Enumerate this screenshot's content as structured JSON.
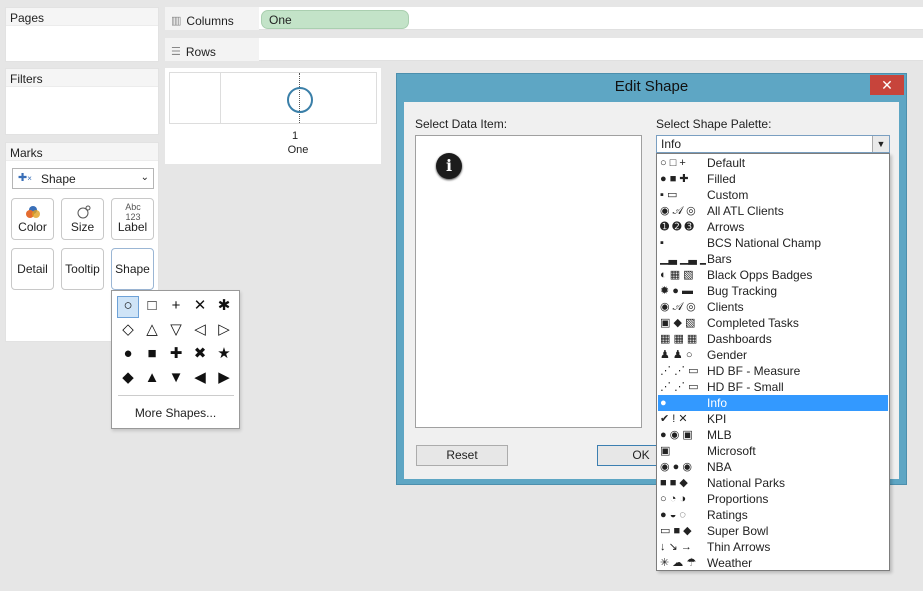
{
  "pages": {
    "title": "Pages"
  },
  "filters": {
    "title": "Filters"
  },
  "marks": {
    "title": "Marks",
    "mark_type": "Shape",
    "buttons": {
      "color": "Color",
      "size": "Size",
      "label": "Label",
      "label_icon": "Abc 123",
      "detail": "Detail",
      "tooltip": "Tooltip",
      "shape": "Shape"
    }
  },
  "shelves": {
    "columns": "Columns",
    "columns_pill": "One",
    "rows": "Rows"
  },
  "view": {
    "tick": "1",
    "category": "One",
    "mark_color": "#3a7fa8"
  },
  "shape_popup": {
    "glyphs": [
      "○",
      "□",
      "+",
      "✕",
      "✱",
      "◇",
      "△",
      "▽",
      "◁",
      "▷",
      "●",
      "■",
      "✚",
      "✖",
      "★",
      "◆",
      "▲",
      "▼",
      "◀",
      "▶"
    ],
    "more": "More Shapes..."
  },
  "dialog": {
    "title": "Edit Shape",
    "close": "✕",
    "select_item_label": "Select Data Item:",
    "select_palette_label": "Select Shape Palette:",
    "selected_palette": "Info",
    "reset": "Reset",
    "ok": "OK",
    "palettes": [
      {
        "name": "Default",
        "icons": "○ □ +"
      },
      {
        "name": "Filled",
        "icons": "● ■ ✚"
      },
      {
        "name": "Custom",
        "icons": "▪ ▭"
      },
      {
        "name": "All ATL Clients",
        "icons": "◉ 𝒜 ◎"
      },
      {
        "name": "Arrows",
        "icons": "➊ ➋ ➌"
      },
      {
        "name": "BCS National Champ",
        "icons": "▪"
      },
      {
        "name": "Bars",
        "icons": "▁▃ ▁▃ ▁▃"
      },
      {
        "name": "Black Opps Badges",
        "icons": "◐ ▦ ▧"
      },
      {
        "name": "Bug Tracking",
        "icons": "✹ ● ▬"
      },
      {
        "name": "Clients",
        "icons": "◉ 𝒜 ◎"
      },
      {
        "name": "Completed Tasks",
        "icons": "▣ ◆ ▧"
      },
      {
        "name": "Dashboards",
        "icons": "▦ ▦ ▦"
      },
      {
        "name": "Gender",
        "icons": "♟ ♟ ○"
      },
      {
        "name": "HD BF - Measure",
        "icons": "⋰ ⋰ ▭"
      },
      {
        "name": "HD BF - Small",
        "icons": "⋰ ⋰ ▭"
      },
      {
        "name": "Info",
        "icons": "●"
      },
      {
        "name": "KPI",
        "icons": "✔ ! ✕"
      },
      {
        "name": "MLB",
        "icons": "● ◉ ▣"
      },
      {
        "name": "Microsoft",
        "icons": "▣"
      },
      {
        "name": "NBA",
        "icons": "◉ ● ◉"
      },
      {
        "name": "National Parks",
        "icons": "■ ■ ◆"
      },
      {
        "name": "Proportions",
        "icons": "○ ◔ ◑"
      },
      {
        "name": "Ratings",
        "icons": "● ◒ ◌"
      },
      {
        "name": "Super Bowl",
        "icons": "▭ ■ ◆"
      },
      {
        "name": "Thin Arrows",
        "icons": "↓ ↘ →"
      },
      {
        "name": "Weather",
        "icons": "✳ ☁ ☂"
      }
    ]
  }
}
